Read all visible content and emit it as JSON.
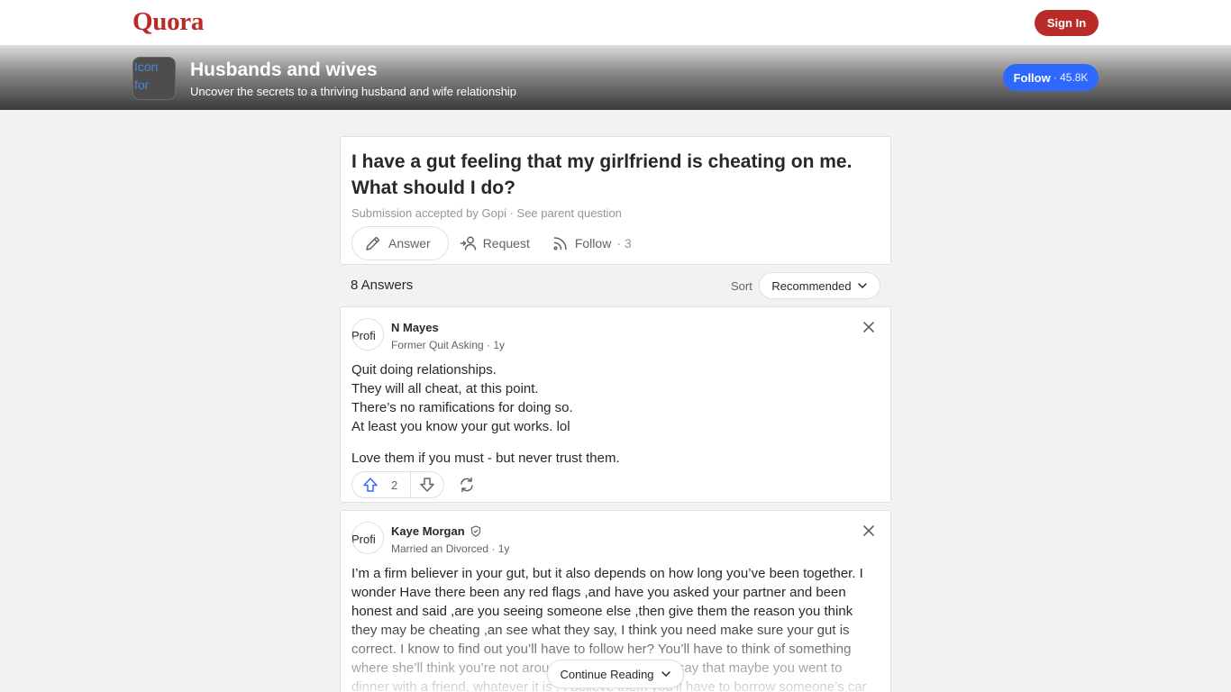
{
  "header": {
    "logo": "Quora",
    "signin_label": "Sign In"
  },
  "space": {
    "icon_alt": "Icon for",
    "title": "Husbands and wives",
    "subtitle": "Uncover the secrets to a thriving husband and wife relationship",
    "follow_label": "Follow",
    "follow_count": "· 45.8K"
  },
  "question": {
    "title": "I have a gut feeling that my girlfriend is cheating on me. What should I do?",
    "meta": "Submission accepted by Gopi · See parent question",
    "answer_label": "Answer",
    "request_label": "Request",
    "follow_label": "Follow",
    "follow_count": "· 3"
  },
  "answers_header": {
    "count": "8 Answers",
    "sort_label": "Sort",
    "sort_value": "Recommended"
  },
  "answers": [
    {
      "avatar_alt": "Profi",
      "name": "N Mayes",
      "credential": "Former Quit Asking · 1y",
      "lines": [
        "Quit doing relationships.",
        "They will all cheat, at this point.",
        "There’s no ramifications for doing so.",
        "At least you know your gut works. lol"
      ],
      "closing": "Love them if you must - but never trust them.",
      "upvotes": "2"
    },
    {
      "avatar_alt": "Profi",
      "name": "Kaye Morgan",
      "credential": "Married an Divorced · 1y",
      "body": "I’m a firm believer in your gut, but it also depends on how long you’ve been together. I wonder Have there been any red flags ,and have you asked your partner and been honest and said ,are you seeing someone else ,then give them the reason you think they may be cheating ,an see what they say, I think you need make sure your gut is correct. I know to find out you’ll have to follow her? You’ll have to think of something where she’ll think you’re not around.,Maybe you could say that maybe you went to dinner with a friend, whatever it is , I believe them you’ll have to borrow someone’s car ,and"
    }
  ],
  "continue_label": "Continue Reading"
}
